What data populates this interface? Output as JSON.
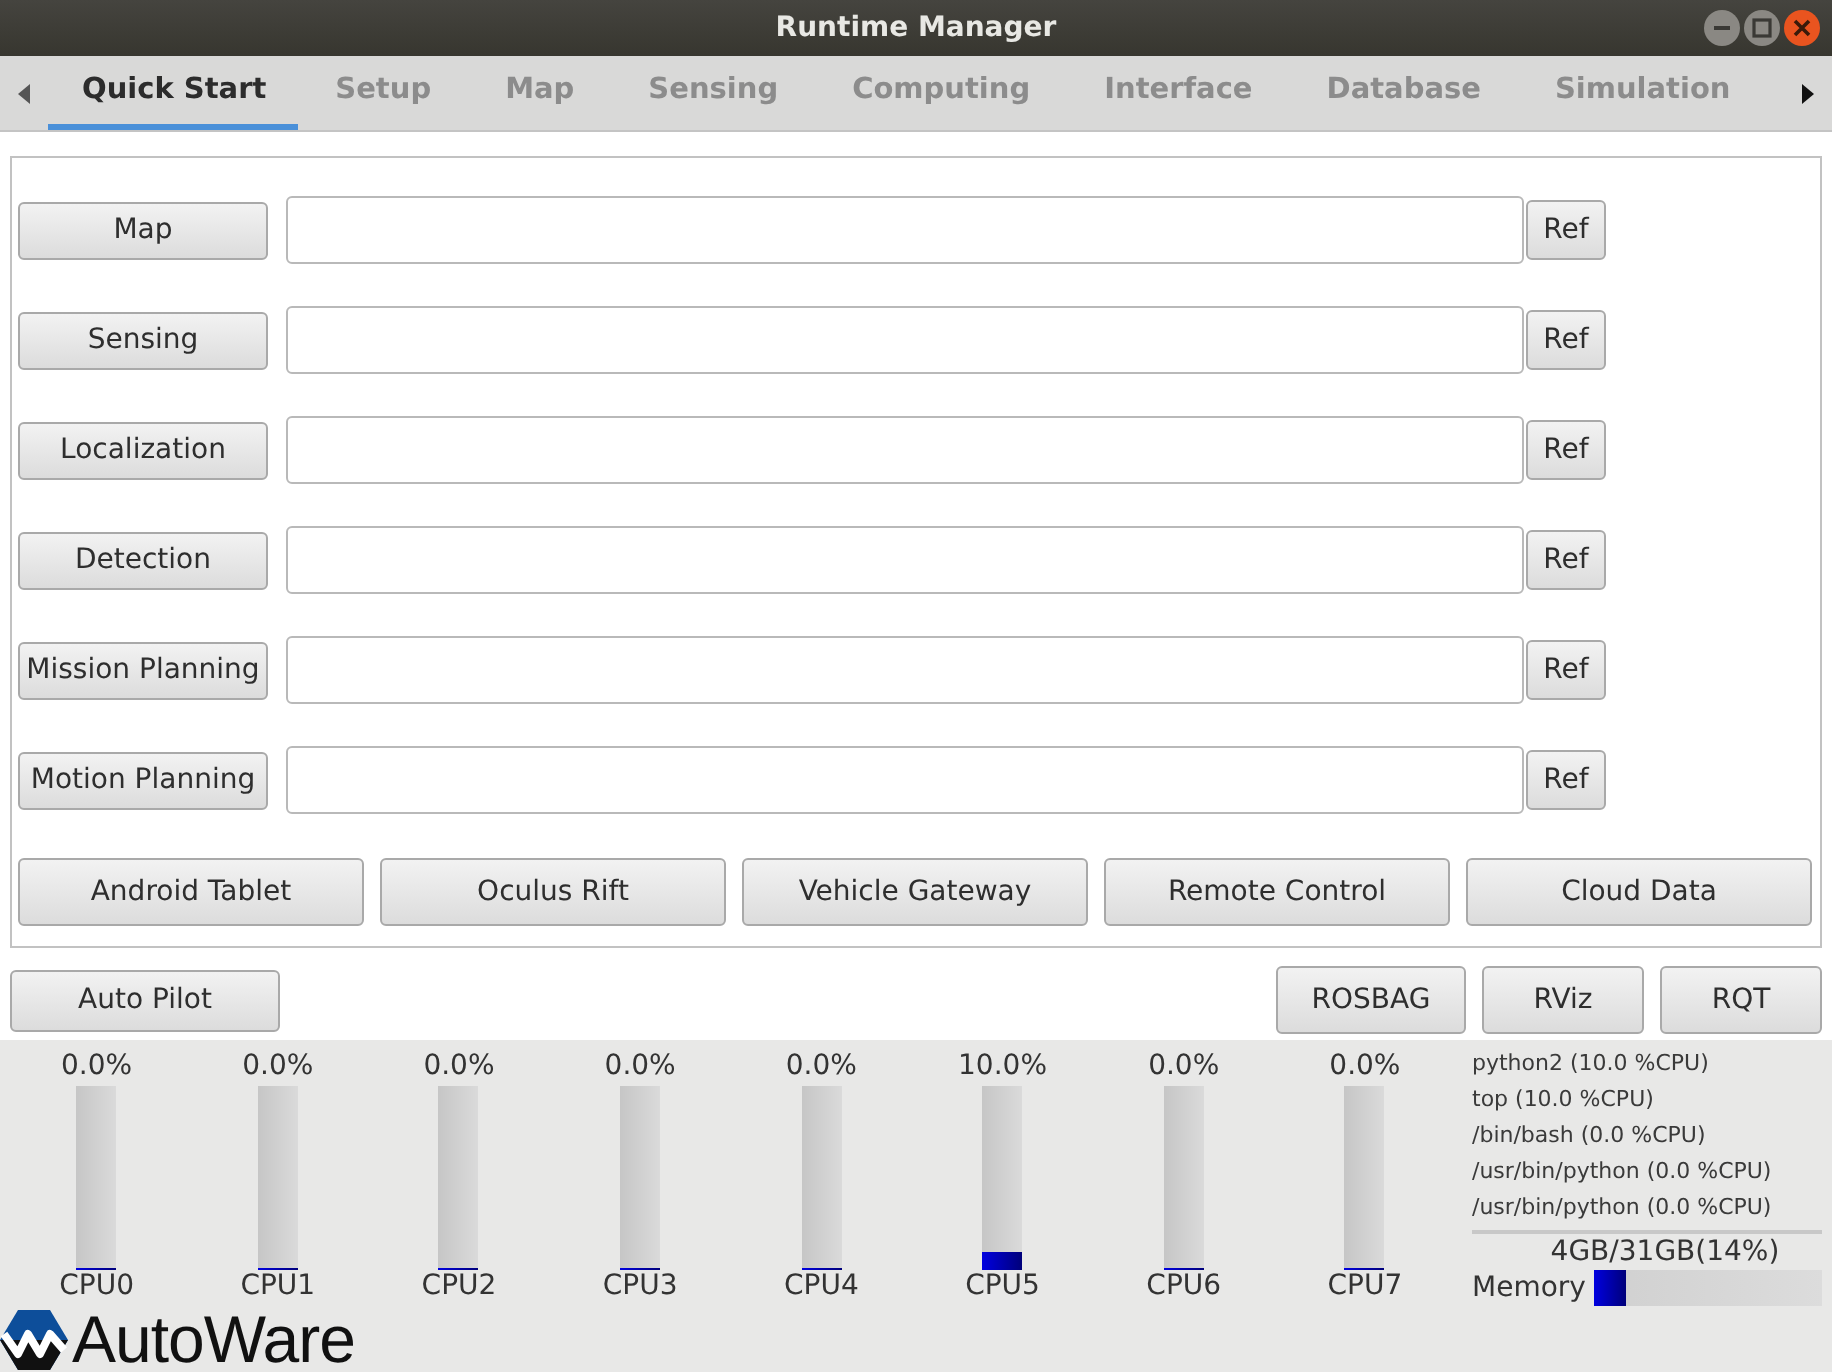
{
  "window": {
    "title": "Runtime Manager"
  },
  "tabs": [
    {
      "label": "Quick Start",
      "selected": true
    },
    {
      "label": "Setup",
      "selected": false
    },
    {
      "label": "Map",
      "selected": false
    },
    {
      "label": "Sensing",
      "selected": false
    },
    {
      "label": "Computing",
      "selected": false
    },
    {
      "label": "Interface",
      "selected": false
    },
    {
      "label": "Database",
      "selected": false
    },
    {
      "label": "Simulation",
      "selected": false
    }
  ],
  "launch_rows": [
    {
      "button": "Map",
      "ref_button": "Ref"
    },
    {
      "button": "Sensing",
      "ref_button": "Ref"
    },
    {
      "button": "Localization",
      "ref_button": "Ref"
    },
    {
      "button": "Detection",
      "ref_button": "Ref"
    },
    {
      "button": "Mission Planning",
      "ref_button": "Ref"
    },
    {
      "button": "Motion Planning",
      "ref_button": "Ref"
    }
  ],
  "tool_buttons": [
    "Android Tablet",
    "Oculus Rift",
    "Vehicle Gateway",
    "Remote Control",
    "Cloud Data"
  ],
  "auto_pilot_button": "Auto Pilot",
  "viewer_buttons": [
    "ROSBAG",
    "RViz",
    "RQT"
  ],
  "cpus": [
    {
      "name": "CPU0",
      "reading": "0.0%",
      "level": 0
    },
    {
      "name": "CPU1",
      "reading": "0.0%",
      "level": 0
    },
    {
      "name": "CPU2",
      "reading": "0.0%",
      "level": 0
    },
    {
      "name": "CPU3",
      "reading": "0.0%",
      "level": 0
    },
    {
      "name": "CPU4",
      "reading": "0.0%",
      "level": 0
    },
    {
      "name": "CPU5",
      "reading": "10.0%",
      "level": 0.1
    },
    {
      "name": "CPU6",
      "reading": "0.0%",
      "level": 0
    },
    {
      "name": "CPU7",
      "reading": "0.0%",
      "level": 0
    }
  ],
  "processes": [
    "python2 (10.0 %CPU)",
    "top (10.0 %CPU)",
    "/bin/bash (0.0 %CPU)",
    "/usr/bin/python (0.0 %CPU)",
    "/usr/bin/python (0.0 %CPU)"
  ],
  "memory": {
    "reading": "4GB/31GB(14%)",
    "label": "Memory",
    "level": 0.14
  },
  "logo": {
    "text": "AutoWare"
  }
}
